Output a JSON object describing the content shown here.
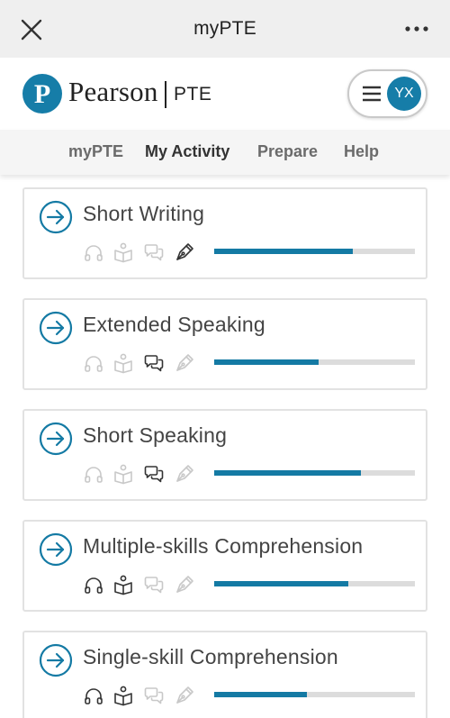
{
  "app": {
    "title": "myPTE"
  },
  "brand": {
    "name": "Pearson",
    "product": "PTE",
    "logo_letter": "P",
    "accent_color": "#147aa4"
  },
  "user": {
    "initials": "YX"
  },
  "nav": {
    "items": [
      {
        "label": "myPTE",
        "active": false
      },
      {
        "label": "My Activity",
        "active": true
      },
      {
        "label": "Prepare",
        "active": false
      },
      {
        "label": "Help",
        "active": false
      }
    ]
  },
  "skill_icons": [
    "headphones-icon",
    "book-reader-icon",
    "speech-bubbles-icon",
    "pen-nib-icon"
  ],
  "cards": [
    {
      "title": "Short Writing",
      "active_skills": [
        false,
        false,
        false,
        true
      ],
      "progress": 0.69
    },
    {
      "title": "Extended Speaking",
      "active_skills": [
        false,
        false,
        true,
        false
      ],
      "progress": 0.52
    },
    {
      "title": "Short Speaking",
      "active_skills": [
        false,
        false,
        true,
        false
      ],
      "progress": 0.73
    },
    {
      "title": "Multiple-skills Comprehension",
      "active_skills": [
        true,
        true,
        false,
        false
      ],
      "progress": 0.67
    },
    {
      "title": "Single-skill Comprehension",
      "active_skills": [
        true,
        true,
        false,
        false
      ],
      "progress": 0.46
    }
  ]
}
